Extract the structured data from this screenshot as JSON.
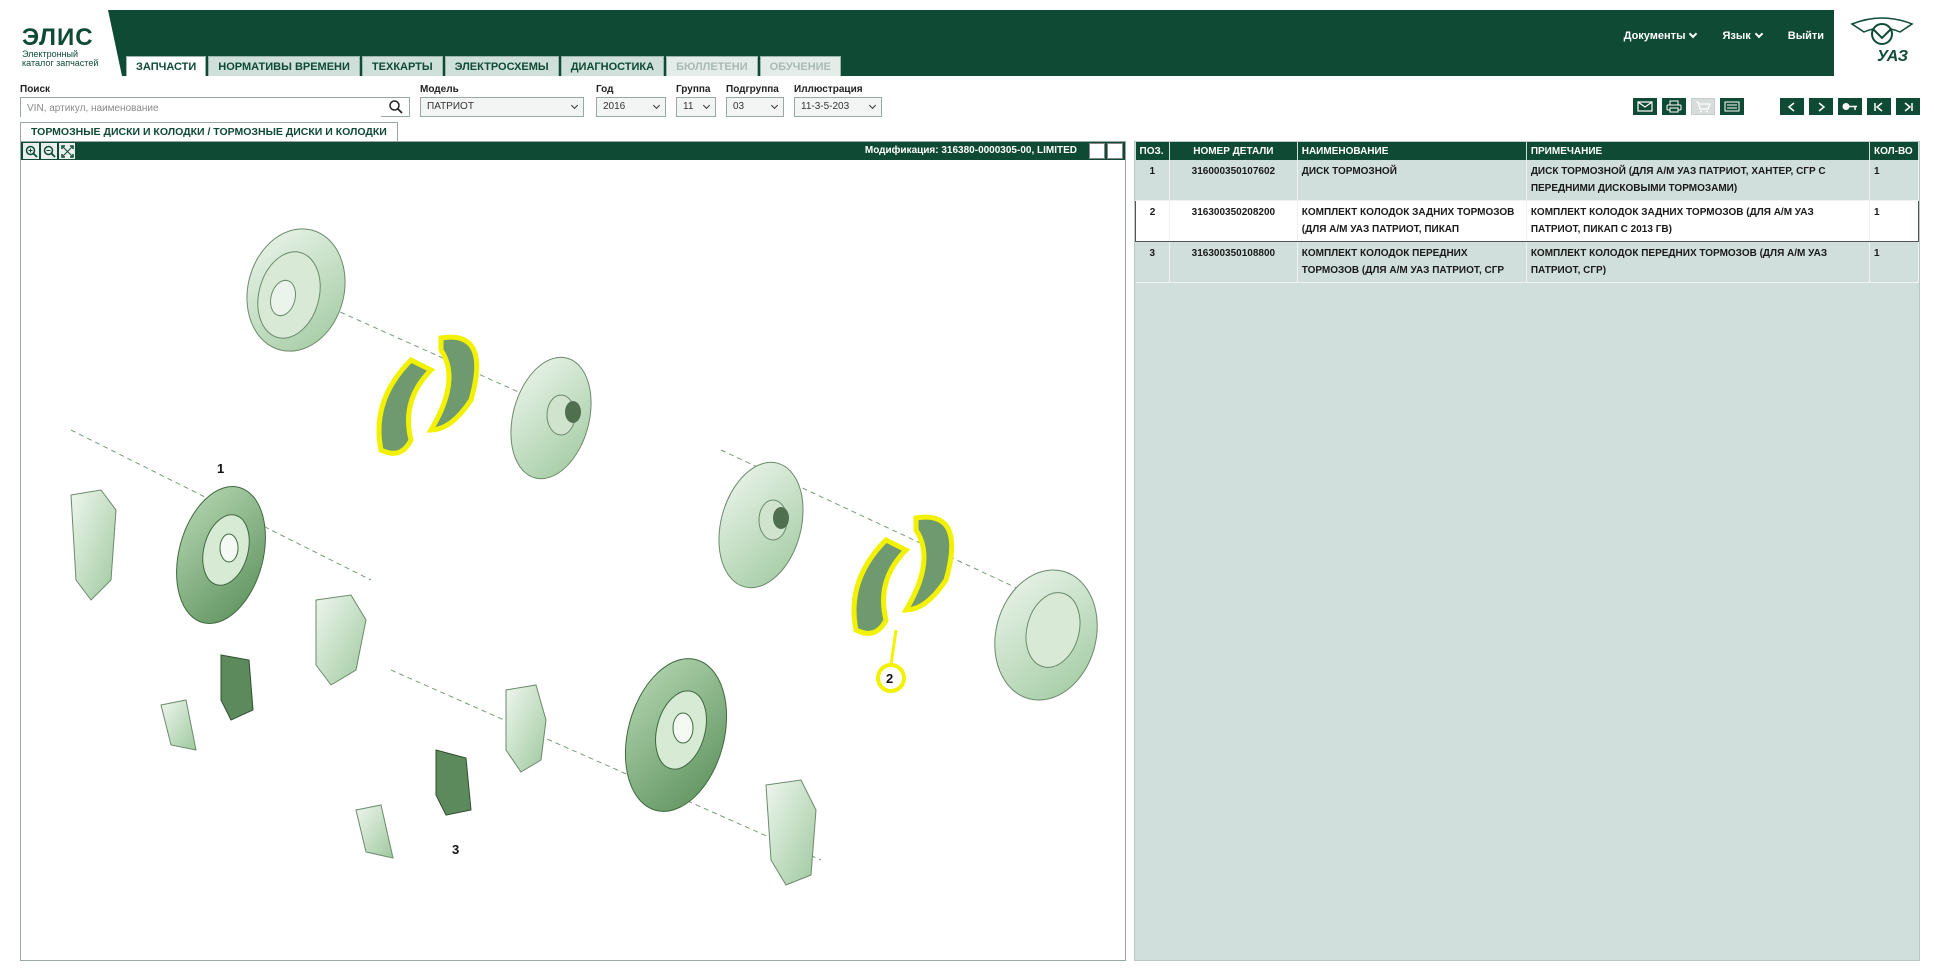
{
  "app": {
    "title": "ЭЛИС",
    "subtitle": "Электронный каталог запчастей",
    "brand": "УАЗ",
    "brand_color": "#0e4a34"
  },
  "tabs": [
    {
      "label": "ЗАПЧАСТИ",
      "state": "active"
    },
    {
      "label": "НОРМАТИВЫ ВРЕМЕНИ",
      "state": "normal"
    },
    {
      "label": "ТЕХКАРТЫ",
      "state": "normal"
    },
    {
      "label": "ЭЛЕКТРОСХЕМЫ",
      "state": "normal"
    },
    {
      "label": "ДИАГНОСТИКА",
      "state": "normal"
    },
    {
      "label": "БЮЛЛЕТЕНИ",
      "state": "disabled"
    },
    {
      "label": "ОБУЧЕНИЕ",
      "state": "disabled"
    }
  ],
  "top_menu": {
    "documents": "Документы",
    "language": "Язык",
    "logout": "Выйти"
  },
  "filters": {
    "search": {
      "label": "Поиск",
      "placeholder": "VIN, артикул, наименование",
      "icon": "search-icon"
    },
    "model": {
      "label": "Модель",
      "value": "ПАТРИОТ"
    },
    "year": {
      "label": "Год",
      "value": "2016"
    },
    "group": {
      "label": "Группа",
      "value": "11"
    },
    "subgroup": {
      "label": "Подгруппа",
      "value": "03"
    },
    "illustration": {
      "label": "Иллюстрация",
      "value": "11-3-5-203"
    }
  },
  "toolbar": {
    "icons": [
      "mail-icon",
      "print-icon",
      "cart-icon",
      "list-icon",
      "prev-icon",
      "next-icon",
      "key-search-icon",
      "first-icon",
      "last-icon"
    ]
  },
  "breadcrumb": "ТОРМОЗНЫЕ ДИСКИ И КОЛОДКИ / ТОРМОЗНЫЕ ДИСКИ И КОЛОДКИ",
  "illustration": {
    "modification": "Модификация: 316380-0000305-00, LIMITED",
    "callouts": [
      "1",
      "2",
      "3"
    ],
    "highlight_color": "#f2f200"
  },
  "parts_table": {
    "headers": [
      "ПОЗ.",
      "НОМЕР ДЕТАЛИ",
      "НАИМЕНОВАНИЕ",
      "ПРИМЕЧАНИЕ",
      "КОЛ-ВО"
    ],
    "selected_index": 1,
    "rows": [
      {
        "pos": "1",
        "number": "316000350107602",
        "name": "ДИСК ТОРМОЗНОЙ",
        "note": "ДИСК ТОРМОЗНОЙ (ДЛЯ А/М УАЗ ПАТРИОТ, ХАНТЕР, СГР С ПЕРЕДНИМИ ДИСКОВЫМИ ТОРМОЗАМИ)",
        "qty": "1"
      },
      {
        "pos": "2",
        "number": "316300350208200",
        "name": "КОМПЛЕКТ КОЛОДОК ЗАДНИХ ТОРМОЗОВ (ДЛЯ А/М УАЗ ПАТРИОТ, ПИКАП",
        "note": "КОМПЛЕКТ КОЛОДОК ЗАДНИХ ТОРМОЗОВ (ДЛЯ А/М УАЗ ПАТРИОТ, ПИКАП С 2013 ГВ)",
        "qty": "1"
      },
      {
        "pos": "3",
        "number": "316300350108800",
        "name": "КОМПЛЕКТ КОЛОДОК ПЕРЕДНИХ ТОРМОЗОВ (ДЛЯ А/М УАЗ ПАТРИОТ, СГР",
        "note": "КОМПЛЕКТ КОЛОДОК ПЕРЕДНИХ ТОРМОЗОВ (ДЛЯ А/М УАЗ ПАТРИОТ, СГР)",
        "qty": "1"
      }
    ]
  }
}
